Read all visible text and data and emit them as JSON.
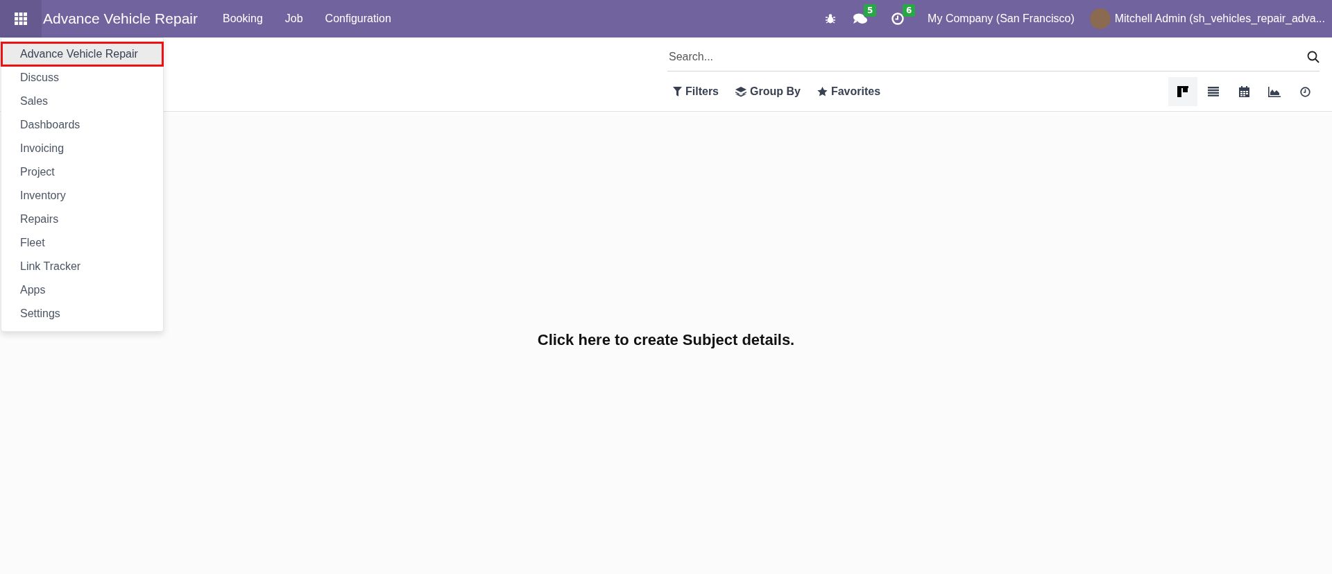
{
  "navbar": {
    "app_title": "Advance Vehicle Repair",
    "menus": [
      "Booking",
      "Job",
      "Configuration"
    ],
    "messages_count": "5",
    "activities_count": "6",
    "company": "My Company (San Francisco)",
    "user": "Mitchell Admin (sh_vehicles_repair_adva..."
  },
  "app_menu": {
    "items": [
      {
        "label": "Advance Vehicle Repair",
        "selected": true
      },
      {
        "label": "Discuss",
        "selected": false
      },
      {
        "label": "Sales",
        "selected": false
      },
      {
        "label": "Dashboards",
        "selected": false
      },
      {
        "label": "Invoicing",
        "selected": false
      },
      {
        "label": "Project",
        "selected": false
      },
      {
        "label": "Inventory",
        "selected": false
      },
      {
        "label": "Repairs",
        "selected": false
      },
      {
        "label": "Fleet",
        "selected": false
      },
      {
        "label": "Link Tracker",
        "selected": false
      },
      {
        "label": "Apps",
        "selected": false
      },
      {
        "label": "Settings",
        "selected": false
      }
    ]
  },
  "search": {
    "placeholder": "Search..."
  },
  "filters": [
    {
      "kind": "filter",
      "label": "Filters"
    },
    {
      "kind": "group",
      "label": "Group By"
    },
    {
      "kind": "favorite",
      "label": "Favorites"
    }
  ],
  "views": [
    {
      "kind": "kanban",
      "selected": true
    },
    {
      "kind": "list",
      "selected": false
    },
    {
      "kind": "calendar",
      "selected": false
    },
    {
      "kind": "graph",
      "selected": false
    },
    {
      "kind": "activity",
      "selected": false
    }
  ],
  "empty_message": "Click here to create Subject details."
}
